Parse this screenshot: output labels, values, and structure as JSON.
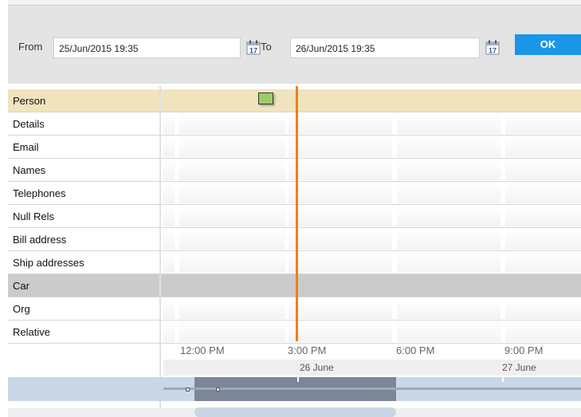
{
  "filter": {
    "from_label": "From",
    "from_value": "25/Jun/2015 19:35",
    "to_label": "To",
    "to_value": "26/Jun/2015 19:35",
    "calendar_day": "17",
    "ok_label": "OK"
  },
  "rows": [
    {
      "label": "Person"
    },
    {
      "label": "Details"
    },
    {
      "label": "Email"
    },
    {
      "label": "Names"
    },
    {
      "label": "Telephones"
    },
    {
      "label": "Null Rels"
    },
    {
      "label": "Bill address"
    },
    {
      "label": "Ship addresses"
    },
    {
      "label": "Car"
    },
    {
      "label": "Org"
    },
    {
      "label": "Relative"
    }
  ],
  "timeline": {
    "time_ticks": [
      "12:00 PM",
      "3:00 PM",
      "6:00 PM",
      "9:00 PM"
    ],
    "day_labels": [
      "26 June",
      "27 June"
    ]
  },
  "colors": {
    "accent": "#1a96e8",
    "now_line": "#f07e1e",
    "person_row": "#efe4bd",
    "car_row": "#cbcbcb",
    "event_marker": "#9ccc6a"
  }
}
